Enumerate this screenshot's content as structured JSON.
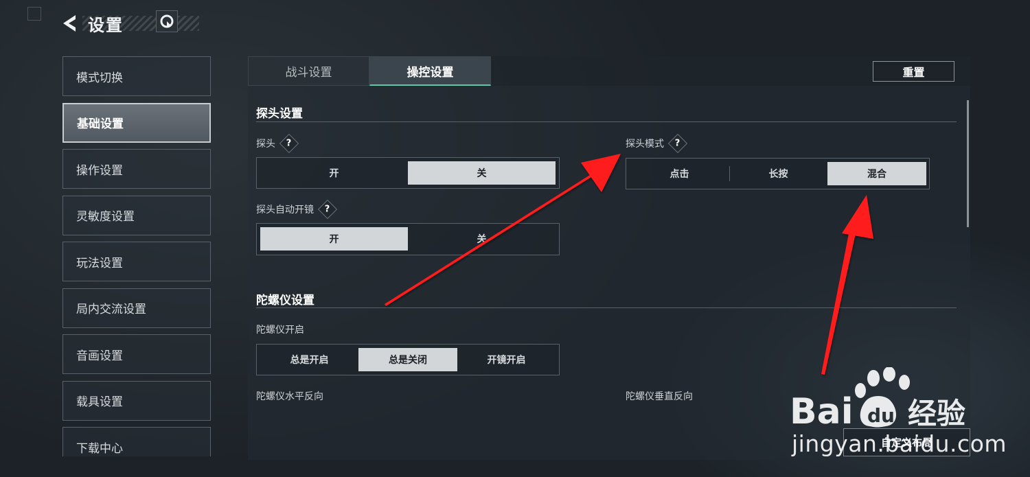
{
  "header": {
    "title": "设置"
  },
  "sidebar": {
    "items": [
      {
        "label": "模式切换"
      },
      {
        "label": "基础设置",
        "active": true
      },
      {
        "label": "操作设置"
      },
      {
        "label": "灵敏度设置"
      },
      {
        "label": "玩法设置"
      },
      {
        "label": "局内交流设置"
      },
      {
        "label": "音画设置"
      },
      {
        "label": "载具设置"
      },
      {
        "label": "下载中心"
      }
    ]
  },
  "tabs": [
    {
      "label": "战斗设置"
    },
    {
      "label": "操控设置",
      "active": true
    }
  ],
  "reset_label": "重置",
  "peek_section": {
    "title": "探头设置",
    "peek": {
      "label": "探头",
      "help": "?",
      "options": [
        "开",
        "关"
      ],
      "selected": "关"
    },
    "peek_mode": {
      "label": "探头模式",
      "help": "?",
      "options": [
        "点击",
        "长按",
        "混合"
      ],
      "selected": "混合"
    },
    "peek_auto_scope": {
      "label": "探头自动开镜",
      "help": "?",
      "options": [
        "开",
        "关"
      ],
      "selected": "开"
    }
  },
  "gyro_section": {
    "title": "陀螺仪设置",
    "gyro_enable": {
      "label": "陀螺仪开启",
      "options": [
        "总是开启",
        "总是关闭",
        "开镜开启"
      ],
      "selected": "总是关闭"
    },
    "gyro_horizontal_label": "陀螺仪水平反向",
    "gyro_vertical_label": "陀螺仪垂直反向"
  },
  "bottom_button_label": "自定义布局",
  "watermark": {
    "brand": "Baidu经验",
    "url": "jingyan.baidu.com"
  },
  "colors": {
    "accent": "#5ec7a6",
    "selected_option": "#d3d6d8",
    "annotation_arrow": "#ff1e1e"
  }
}
